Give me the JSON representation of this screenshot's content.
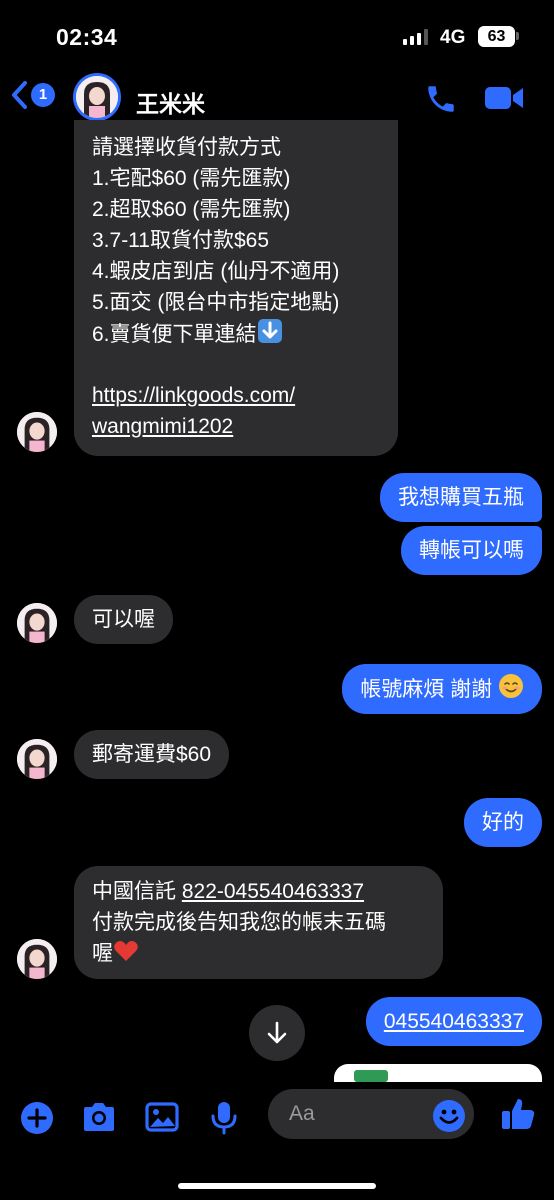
{
  "status_bar": {
    "time": "02:34",
    "network": "4G",
    "battery": "63"
  },
  "header": {
    "unread_count": "1",
    "contact_name": "王米米"
  },
  "messages": [
    {
      "direction": "incoming",
      "lines": [
        "請選擇收貨付款方式",
        "1.宅配$60 (需先匯款)",
        "2.超取$60 (需先匯款)",
        "3.7-11取貨付款$65",
        "4.蝦皮店到店 (仙丹不適用)",
        "5.面交 (限台中市指定地點)",
        "6.賣貨便下單連結",
        "",
        "https://linkgoods.com/",
        "wangmimi1202"
      ],
      "emoji": "down-arrow-emoji"
    },
    {
      "direction": "outgoing",
      "text": "我想購買五瓶"
    },
    {
      "direction": "outgoing",
      "text": "轉帳可以嗎"
    },
    {
      "direction": "incoming",
      "text": "可以喔"
    },
    {
      "direction": "outgoing",
      "text": "帳號麻煩 謝謝",
      "emoji": "smiling-face-emoji"
    },
    {
      "direction": "incoming",
      "text": "郵寄運費$60"
    },
    {
      "direction": "outgoing",
      "text": "好的"
    },
    {
      "direction": "incoming",
      "bank": "中國信託",
      "account": "822-045540463337",
      "line2": "付款完成後告知我您的帳末五碼",
      "line3": "喔",
      "emoji": "red-heart-emoji"
    },
    {
      "direction": "outgoing",
      "text": "045540463337"
    }
  ],
  "composer": {
    "placeholder": "Aa"
  },
  "colors": {
    "accent": "#2f6bff",
    "incoming_bubble": "#2d2d2f",
    "background": "#000000"
  }
}
